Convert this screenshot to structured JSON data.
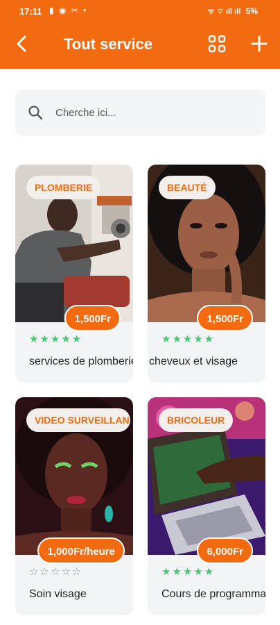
{
  "status_bar": {
    "time": "17:11",
    "left_icons": "▮ ◉ ✂ •",
    "signal": "ᯤ ⌔ ıll ıll",
    "battery": "5%"
  },
  "header": {
    "title": "Tout service",
    "back_icon": "chevron-left-icon",
    "grid_icon": "grid-icon",
    "add_icon": "plus-icon"
  },
  "search": {
    "placeholder": "Cherche ici..."
  },
  "colors": {
    "accent": "#f36b10",
    "star_filled": "#4cc77a",
    "star_empty": "#9a9a9a",
    "card_bg": "#f3f4f6"
  },
  "services": [
    {
      "category": "PLOMBERIE",
      "price": "1,500Fr",
      "stars": "★★★★★",
      "rating": 5,
      "title": "services de plomberie"
    },
    {
      "category": "BEAUTÉ",
      "price": "1,500Fr",
      "stars": "★★★★★",
      "rating": 5,
      "title": "cheveux et visage"
    },
    {
      "category": "VIDEO SURVEILLANCE",
      "price": "1,000Fr/heure",
      "stars": "☆☆☆☆☆",
      "rating": 0,
      "title": "Soin visage"
    },
    {
      "category": "BRICOLEUR",
      "price": "6,000Fr",
      "stars": "★★★★★",
      "rating": 5,
      "title": "Cours de programmation"
    }
  ]
}
